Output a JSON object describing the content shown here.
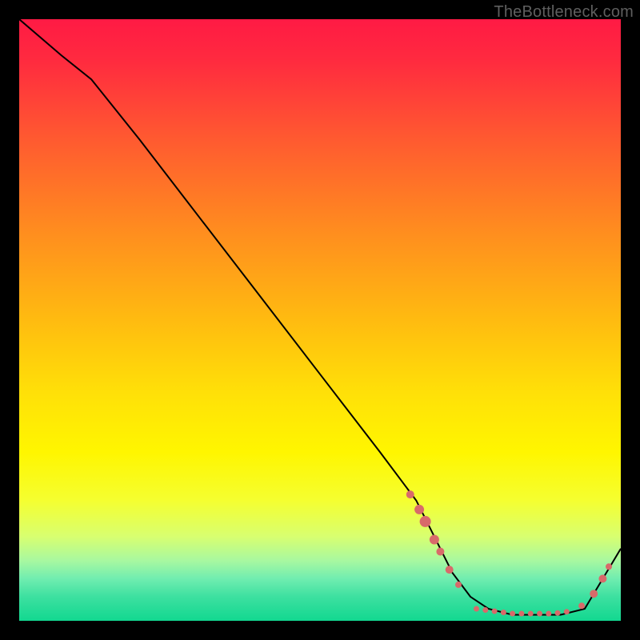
{
  "attribution": "TheBottleneck.com",
  "chart_data": {
    "type": "line",
    "title": "",
    "xlabel": "",
    "ylabel": "",
    "xlim": [
      0,
      100
    ],
    "ylim": [
      0,
      100
    ],
    "background_gradient": {
      "stops": [
        {
          "offset": 0.0,
          "color": "#ff1a44"
        },
        {
          "offset": 0.07,
          "color": "#ff2b3f"
        },
        {
          "offset": 0.2,
          "color": "#ff5a30"
        },
        {
          "offset": 0.35,
          "color": "#ff8c1f"
        },
        {
          "offset": 0.5,
          "color": "#ffbb10"
        },
        {
          "offset": 0.62,
          "color": "#ffe008"
        },
        {
          "offset": 0.72,
          "color": "#fff600"
        },
        {
          "offset": 0.8,
          "color": "#f5ff30"
        },
        {
          "offset": 0.86,
          "color": "#d8ff70"
        },
        {
          "offset": 0.9,
          "color": "#a8f8a0"
        },
        {
          "offset": 0.93,
          "color": "#70edb0"
        },
        {
          "offset": 0.96,
          "color": "#3de0a0"
        },
        {
          "offset": 1.0,
          "color": "#12d890"
        }
      ]
    },
    "series": [
      {
        "name": "bottleneck-curve",
        "x": [
          0,
          7,
          12,
          20,
          30,
          40,
          50,
          60,
          66,
          68,
          70,
          72,
          75,
          78,
          82,
          86,
          90,
          94,
          100
        ],
        "y": [
          100,
          94,
          90,
          80,
          67,
          54,
          41,
          28,
          20,
          16,
          12,
          8,
          4,
          2,
          1,
          1,
          1,
          2,
          12
        ]
      }
    ],
    "markers": [
      {
        "name": "cluster-left-a",
        "x": 65.0,
        "y": 21.0,
        "r": 5
      },
      {
        "name": "cluster-left-b",
        "x": 66.5,
        "y": 18.5,
        "r": 6
      },
      {
        "name": "cluster-left-c",
        "x": 67.5,
        "y": 16.5,
        "r": 7
      },
      {
        "name": "cluster-left-d",
        "x": 69.0,
        "y": 13.5,
        "r": 6
      },
      {
        "name": "cluster-left-e",
        "x": 70.0,
        "y": 11.5,
        "r": 5
      },
      {
        "name": "cluster-left-f",
        "x": 71.5,
        "y": 8.5,
        "r": 5
      },
      {
        "name": "cluster-left-g",
        "x": 73.0,
        "y": 6.0,
        "r": 4
      },
      {
        "name": "flat-a",
        "x": 76.0,
        "y": 2.0,
        "r": 3.5
      },
      {
        "name": "flat-b",
        "x": 77.5,
        "y": 1.8,
        "r": 3.5
      },
      {
        "name": "flat-c",
        "x": 79.0,
        "y": 1.6,
        "r": 3.5
      },
      {
        "name": "flat-d",
        "x": 80.5,
        "y": 1.4,
        "r": 3.5
      },
      {
        "name": "flat-e",
        "x": 82.0,
        "y": 1.2,
        "r": 3.5
      },
      {
        "name": "flat-f",
        "x": 83.5,
        "y": 1.2,
        "r": 3.5
      },
      {
        "name": "flat-g",
        "x": 85.0,
        "y": 1.2,
        "r": 3.5
      },
      {
        "name": "flat-h",
        "x": 86.5,
        "y": 1.2,
        "r": 3.5
      },
      {
        "name": "flat-i",
        "x": 88.0,
        "y": 1.2,
        "r": 3.5
      },
      {
        "name": "flat-j",
        "x": 89.5,
        "y": 1.3,
        "r": 3.5
      },
      {
        "name": "flat-k",
        "x": 91.0,
        "y": 1.5,
        "r": 3.5
      },
      {
        "name": "rise-a",
        "x": 93.5,
        "y": 2.5,
        "r": 4
      },
      {
        "name": "rise-b",
        "x": 95.5,
        "y": 4.5,
        "r": 5
      },
      {
        "name": "rise-c",
        "x": 97.0,
        "y": 7.0,
        "r": 5
      },
      {
        "name": "rise-d",
        "x": 98.0,
        "y": 9.0,
        "r": 4
      }
    ],
    "marker_color": "#d86a6a",
    "line_color": "#000000"
  }
}
